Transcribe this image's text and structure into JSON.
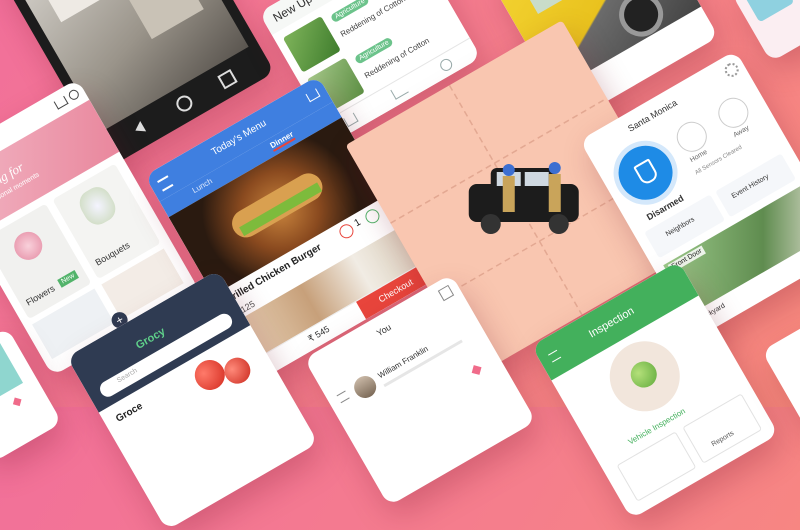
{
  "colors": {
    "bg_start": "#f2709a",
    "bg_end": "#f88a7d",
    "food_blue": "#3f7fe0",
    "checkout_red": "#e8453c",
    "inspect_green": "#43b05c",
    "home_blue": "#1e8be6",
    "grocery_dark": "#2f3b52",
    "taxi_peach": "#f9c6b0"
  },
  "flower_app": {
    "banner_title": "Blooming for",
    "banner_sub": "All the personal moments",
    "cat1": "Flowers",
    "cat1_badge": "New",
    "cat2": "Bouquets"
  },
  "food_app": {
    "header_title": "Today's Menu",
    "tabs": [
      "Lunch",
      "Dinner"
    ],
    "dish1_name": "Grilled Chicken Burger",
    "dish1_price": "₹ 125",
    "dish1_qty": "1",
    "dish2_price": "₹ 545",
    "checkout_label": "Checkout"
  },
  "plant_app": {
    "header": "New Upd",
    "items": [
      {
        "title": "Reddening of Cotton",
        "badge": "Agriculture"
      },
      {
        "title": "Reddening of Cotton",
        "badge": "Agriculture"
      }
    ]
  },
  "home_app": {
    "location": "Santa Monica",
    "main_status": "Disarmed",
    "modes": [
      "Home",
      "Away"
    ],
    "all_sensors": "All Sensors Cleared",
    "tile1": "Neighbors",
    "tile2": "Event History",
    "cam1": "Front Door",
    "cam2": "Backyard"
  },
  "grocery_app": {
    "title": "Grocy",
    "search_label": "Search",
    "section": "Groce"
  },
  "social_app": {
    "title": "You",
    "user_name": "William Franklin"
  },
  "inspect_app": {
    "title": "Inspection",
    "section_label": "Vehicle Inspection",
    "reports": "Reports"
  },
  "icons": [
    "search-icon",
    "home-icon",
    "plus-icon",
    "cart-icon",
    "menu-icon",
    "gear-icon",
    "shield-icon",
    "user-icon",
    "heart-icon"
  ]
}
